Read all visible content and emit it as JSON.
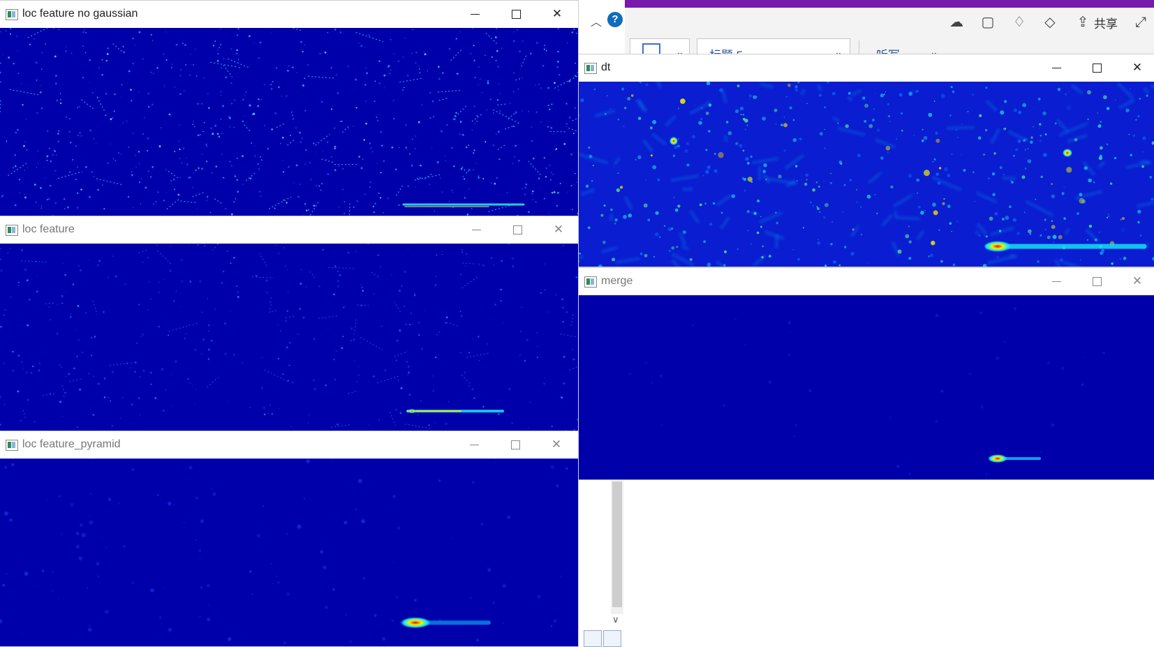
{
  "background_app": {
    "share_label": "共享",
    "style_box_text": "标题 5",
    "dictate_text": "听写",
    "help_icon_label": "?"
  },
  "windows": [
    {
      "id": "w1",
      "title": "loc feature no gaussian"
    },
    {
      "id": "w2",
      "title": "loc feature"
    },
    {
      "id": "w3",
      "title": "loc feature_pyramid"
    },
    {
      "id": "w4",
      "title": "dt"
    },
    {
      "id": "w5",
      "title": "merge"
    }
  ],
  "window_controls": {
    "minimize": "—",
    "maximize": "☐",
    "close": "✕"
  },
  "colors": {
    "heatmap_background": "#0000aa",
    "dt_background": "#0a1dd0",
    "highlight_red": "#e01010",
    "highlight_yellow": "#f5f000",
    "highlight_cyan": "#10e8f0",
    "onenote_purple": "#7719aa"
  }
}
